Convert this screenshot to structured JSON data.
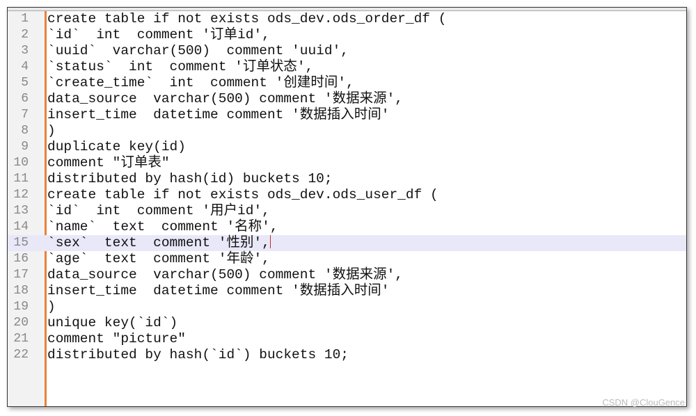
{
  "editor": {
    "current_line": 15,
    "accent_color": "#e8823a",
    "highlight_color": "#e8e8f8",
    "lines": [
      "create table if not exists ods_dev.ods_order_df (",
      "`id`  int  comment '订单id',",
      "`uuid`  varchar(500)  comment 'uuid',",
      "`status`  int  comment '订单状态',",
      "`create_time`  int  comment '创建时间',",
      "data_source  varchar(500) comment '数据来源',",
      "insert_time  datetime comment '数据插入时间'",
      ")",
      "duplicate key(id)",
      "comment \"订单表\"",
      "distributed by hash(id) buckets 10;",
      "create table if not exists ods_dev.ods_user_df (",
      "`id`  int  comment '用户id',",
      "`name`  text  comment '名称',",
      "`sex`  text  comment '性别',",
      "`age`  text  comment '年龄',",
      "data_source  varchar(500) comment '数据来源',",
      "insert_time  datetime comment '数据插入时间'",
      ")",
      "unique key(`id`)",
      "comment \"picture\"",
      "distributed by hash(`id`) buckets 10;"
    ]
  },
  "watermark": "CSDN @ClouGence"
}
